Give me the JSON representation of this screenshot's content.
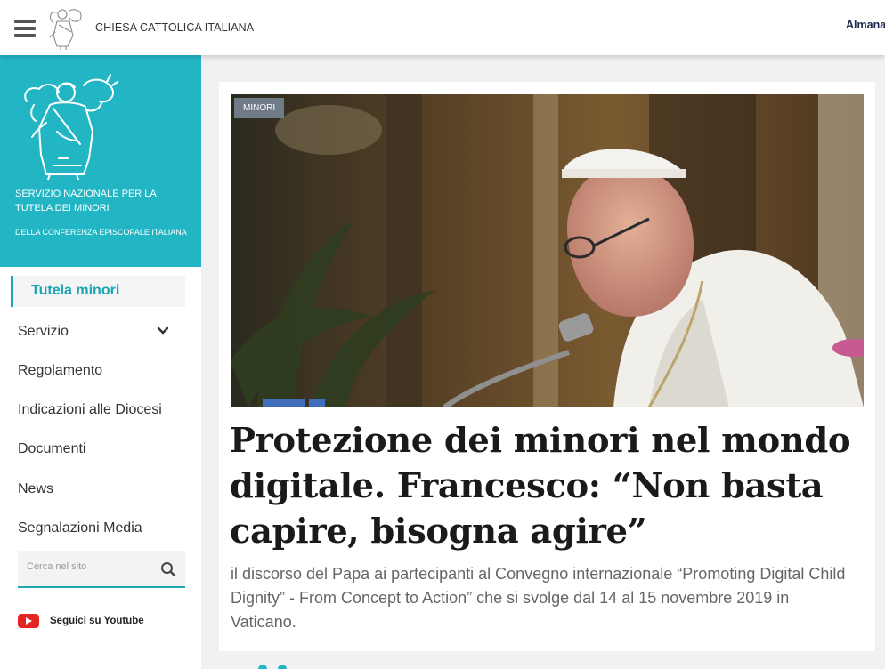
{
  "header": {
    "site_name": "CHIESA CATTOLICA ITALIANA",
    "right_link": "Almanacco"
  },
  "brand": {
    "title": "SERVIZIO NAZIONALE PER LA TUTELA DEI MINORI",
    "subtitle": "DELLA CONFERENZA EPISCOPALE ITALIANA"
  },
  "nav": {
    "active": "Tutela minori",
    "items": [
      "Servizio",
      "Regolamento",
      "Indicazioni alle Diocesi",
      "Documenti",
      "News",
      "Segnalazioni Media"
    ]
  },
  "search": {
    "placeholder": "Cerca nel sito"
  },
  "youtube": {
    "label": "Seguici su Youtube"
  },
  "article": {
    "tag": "MINORI",
    "title": "Protezione dei minori nel mondo digitale. Francesco: “Non basta capire, bisogna agire”",
    "summary": "il discorso del Papa ai partecipanti al Convegno internazionale “Promoting Digital Child Dignity” - From Concept to Action” che si svolge dal 14 al 15 novembre 2019 in Vaticano."
  },
  "colors": {
    "brand_teal": "#22b6c4",
    "accent": "#1fa7b5",
    "tag_bg": "#6f7b87",
    "youtube_red": "#e52521"
  }
}
